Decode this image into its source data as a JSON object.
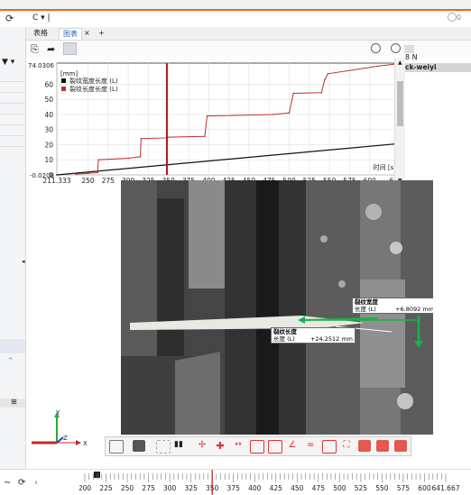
{
  "toolbar": {
    "refresh_icon": "refresh-icon",
    "url_value": "C ▾ |",
    "badge": "0"
  },
  "tabs": [
    {
      "label": "表格"
    },
    {
      "label": "图表"
    }
  ],
  "tab_close": "×",
  "tab_add": "+",
  "right_panel": {
    "unit": "8 N",
    "name": "ck-weiyi"
  },
  "chart_data": {
    "type": "line",
    "unit_label": "[mm]",
    "x_label": "时间 [s]",
    "y_ticks": [
      0,
      10,
      20,
      30,
      40,
      50,
      60
    ],
    "y_top_label": "74.0306",
    "y_bottom_label": "-0.0208",
    "x_ticks": [
      "211.333",
      "250",
      "275",
      "300",
      "325",
      "350",
      "375",
      "400",
      "425",
      "450",
      "475",
      "500",
      "525",
      "550",
      "575",
      "600",
      "641.667"
    ],
    "ylim": [
      -0.0208,
      74.0306
    ],
    "xlim": [
      211.333,
      641.667
    ],
    "cursor_x": 348,
    "series": [
      {
        "name": "裂纹宽度长度 (L)",
        "color": "#111111",
        "x": [
          211.333,
          641.667
        ],
        "y": [
          0,
          21
        ]
      },
      {
        "name": "裂纹长度长度 (L)",
        "color": "#c0302b",
        "x": [
          235,
          250,
          262,
          263,
          300,
          315,
          316,
          348,
          349,
          395,
          398,
          480,
          500,
          505,
          540,
          544,
          548,
          610,
          641.667
        ],
        "y": [
          0.5,
          1,
          1.5,
          10,
          11,
          12,
          24,
          24.5,
          25,
          25.5,
          39,
          40,
          41,
          54,
          54.5,
          63,
          67,
          72,
          74
        ]
      }
    ]
  },
  "measurements": [
    {
      "title": "裂纹宽度",
      "label": "长度 (L)",
      "value": "+6.8092 mm"
    },
    {
      "title": "裂纹长度",
      "label": "长度 (L)",
      "value": "+24.2512 mm"
    }
  ],
  "axis_labels": {
    "x": "X",
    "y": "Y",
    "z": "Z"
  },
  "timeline": {
    "ticks": [
      "200",
      "225",
      "250",
      "275",
      "300",
      "325",
      "350",
      "375",
      "400",
      "425",
      "450",
      "475",
      "500",
      "525",
      "550",
      "575",
      "600",
      "641.667"
    ]
  }
}
